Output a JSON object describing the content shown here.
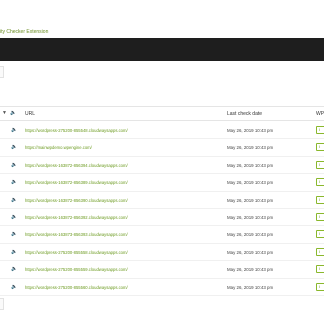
{
  "extension_title": "ity Checker Extension",
  "table": {
    "columns": {
      "sort_indicator": "▼",
      "speaker_icon": "speaker-icon",
      "url": "URL",
      "last_check_date": "Last check date",
      "action": "WP"
    },
    "rows": [
      {
        "url": "https://wordpress-275200-855548.cloudwaysapps.com/",
        "date": "May 26, 2019 10:43 pm",
        "button": "I"
      },
      {
        "url": "https://mainwpdemo.wpengine.com/",
        "date": "May 26, 2019 10:43 pm",
        "button": "I"
      },
      {
        "url": "https://wordpress-163872-856394.cloudwaysapps.com/",
        "date": "May 26, 2019 10:43 pm",
        "button": "I"
      },
      {
        "url": "https://wordpress-163872-856389.cloudwaysapps.com/",
        "date": "May 26, 2019 10:43 pm",
        "button": "I"
      },
      {
        "url": "https://wordpress-163872-856390.cloudwaysapps.com/",
        "date": "May 26, 2019 10:43 pm",
        "button": "I"
      },
      {
        "url": "https://wordpress-163872-856392.cloudwaysapps.com/",
        "date": "May 26, 2019 10:43 pm",
        "button": "I"
      },
      {
        "url": "https://wordpress-163873-856393.cloudwaysapps.com/",
        "date": "May 26, 2019 10:43 pm",
        "button": "I"
      },
      {
        "url": "https://wordpress-275200-855558.cloudwaysapps.com/",
        "date": "May 26, 2019 10:43 pm",
        "button": "I"
      },
      {
        "url": "https://wordpress-275200-855559.cloudwaysapps.com/",
        "date": "May 26, 2019 10:43 pm",
        "button": "I"
      },
      {
        "url": "https://wordpress-275200-855560.cloudwaysapps.com/",
        "date": "May 26, 2019 10:43 pm",
        "button": "I"
      }
    ]
  },
  "colors": {
    "accent_green": "#6b9a1f",
    "dark_bar": "#1e1e1e"
  }
}
